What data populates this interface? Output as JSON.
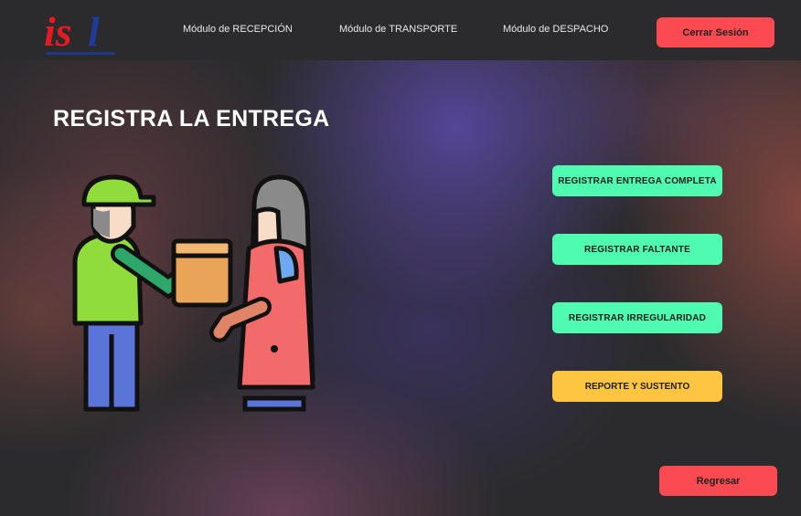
{
  "header": {
    "logo_text": "isl",
    "nav": [
      {
        "label": "Módulo de RECEPCIÓN"
      },
      {
        "label": "Módulo de TRANSPORTE"
      },
      {
        "label": "Módulo de DESPACHO"
      }
    ],
    "logout_label": "Cerrar Sesión"
  },
  "main": {
    "title": "REGISTRA LA ENTREGA",
    "illustration_icon": "delivery-handover-icon",
    "actions": [
      {
        "label": "REGISTRAR ENTREGA COMPLETA"
      },
      {
        "label": "REGISTRAR FALTANTE"
      },
      {
        "label": "REGISTRAR IRREGULARIDAD"
      },
      {
        "label": "REPORTE Y SUSTENTO"
      }
    ],
    "back_label": "Regresar"
  },
  "colors": {
    "background": "#2b2b2d",
    "accent_red": "#fb4a52",
    "accent_green": "#4efbb0",
    "accent_yellow": "#fec543",
    "logo_red": "#e31b23",
    "logo_blue": "#1f3b9a"
  }
}
